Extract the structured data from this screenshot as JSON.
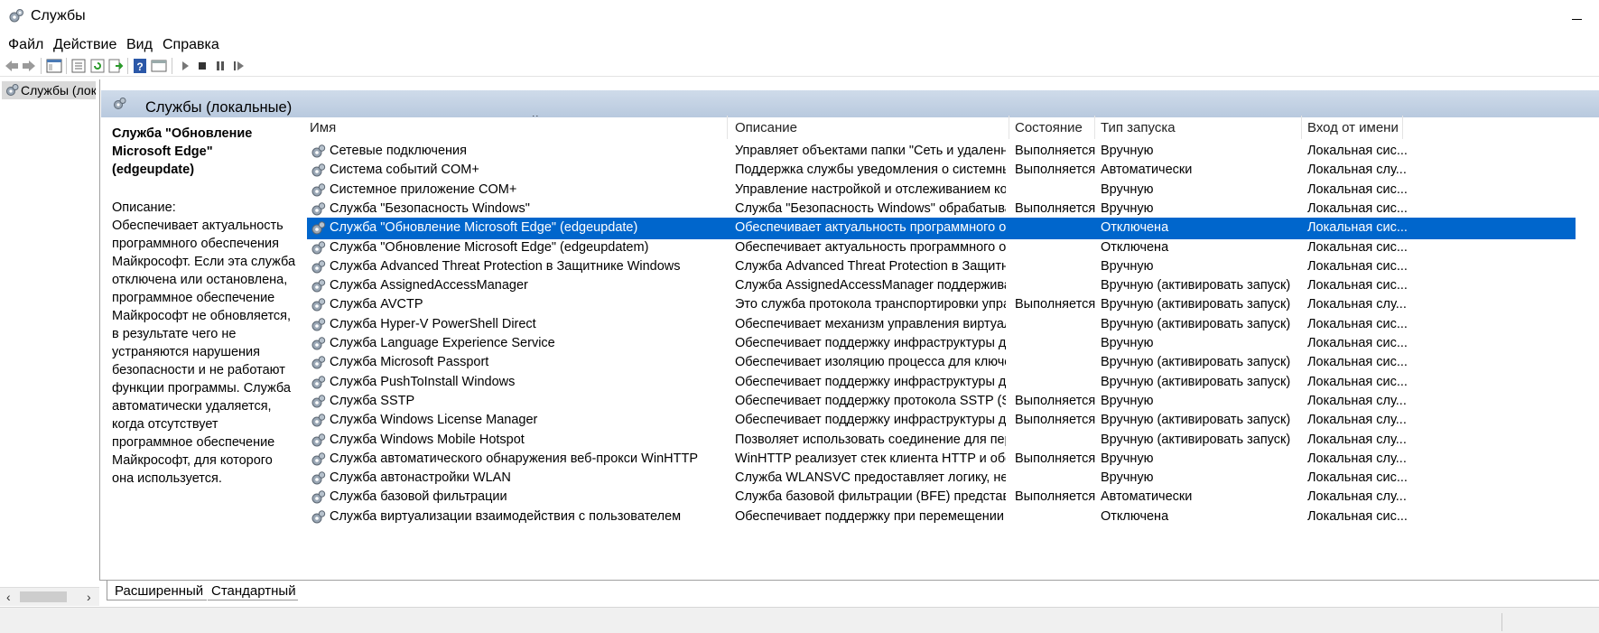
{
  "window": {
    "title": "Службы",
    "icon": "gears-icon"
  },
  "menu": [
    "Файл",
    "Действие",
    "Вид",
    "Справка"
  ],
  "toolbar": {
    "buttons": [
      "back-arrow-icon",
      "forward-arrow-icon",
      "show-hide-tree-icon",
      "properties-icon",
      "refresh-icon",
      "export-icon",
      "help-icon",
      "console-icon",
      "play-icon",
      "stop-icon",
      "pause-icon",
      "restart-icon"
    ]
  },
  "tree": {
    "item_label": "Службы (лока"
  },
  "header": {
    "title": "Службы (локальные)"
  },
  "description": {
    "service_name": "Служба \"Обновление Microsoft Edge\" (edgeupdate)",
    "label": "Описание:",
    "text": "Обеспечивает актуальность программного обеспечения Майкрософт. Если эта служба отключена или остановлена, программное обеспечение Майкрософт не обновляется, в результате чего не устраняются нарушения безопасности и не работают функции программы. Служба автоматически удаляется, когда отсутствует программное обеспечение Майкрософт, для которого она используется."
  },
  "table": {
    "columns": [
      "Имя",
      "Описание",
      "Состояние",
      "Тип запуска",
      "Вход от имени"
    ],
    "sort_indicator": "^",
    "rows": [
      [
        "Сетевые подключения",
        "Управляет объектами папки \"Сеть и удаленны...",
        "Выполняется",
        "Вручную",
        "Локальная сис..."
      ],
      [
        "Система событий COM+",
        "Поддержка службы уведомления о системных ...",
        "Выполняется",
        "Автоматически",
        "Локальная слу..."
      ],
      [
        "Системное приложение COM+",
        "Управление настройкой и отслеживанием ком...",
        "",
        "Вручную",
        "Локальная сис..."
      ],
      [
        "Служба \"Безопасность Windows\"",
        "Служба \"Безопасность Windows\" обрабатывае...",
        "Выполняется",
        "Вручную",
        "Локальная сис..."
      ],
      [
        "Служба \"Обновление Microsoft Edge\" (edgeupdate)",
        "Обеспечивает актуальность программного об...",
        "",
        "Отключена",
        "Локальная сис..."
      ],
      [
        "Служба \"Обновление Microsoft Edge\" (edgeupdatem)",
        "Обеспечивает актуальность программного об...",
        "",
        "Отключена",
        "Локальная сис..."
      ],
      [
        "Служба Advanced Threat Protection в Защитнике Windows",
        "Служба Advanced Threat Protection в Защитник...",
        "",
        "Вручную",
        "Локальная сис..."
      ],
      [
        "Служба AssignedAccessManager",
        "Служба AssignedAccessManager поддерживает ...",
        "",
        "Вручную (активировать запуск)",
        "Локальная сис..."
      ],
      [
        "Служба AVCTP",
        "Это служба протокола транспортировки управ...",
        "Выполняется",
        "Вручную (активировать запуск)",
        "Локальная слу..."
      ],
      [
        "Служба Hyper-V PowerShell Direct",
        "Обеспечивает механизм управления виртуаль...",
        "",
        "Вручную (активировать запуск)",
        "Локальная сис..."
      ],
      [
        "Служба Language Experience Service",
        "Обеспечивает поддержку инфраструктуры для ...",
        "",
        "Вручную",
        "Локальная сис..."
      ],
      [
        "Служба Microsoft Passport",
        "Обеспечивает изоляцию процесса для ключей...",
        "",
        "Вручную (активировать запуск)",
        "Локальная сис..."
      ],
      [
        "Служба PushToInstall Windows",
        "Обеспечивает поддержку инфраструктуры для ...",
        "",
        "Вручную (активировать запуск)",
        "Локальная сис..."
      ],
      [
        "Служба SSTP",
        "Обеспечивает поддержку протокола SSTP (Sec...",
        "Выполняется",
        "Вручную",
        "Локальная слу..."
      ],
      [
        "Служба Windows License Manager",
        "Обеспечивает поддержку инфраструктуры для ...",
        "Выполняется",
        "Вручную (активировать запуск)",
        "Локальная слу..."
      ],
      [
        "Служба Windows Mobile Hotspot",
        "Позволяет использовать соединение для пере...",
        "",
        "Вручную (активировать запуск)",
        "Локальная слу..."
      ],
      [
        "Служба автоматического обнаружения веб-прокси WinHTTP",
        "WinHTTP реализует стек клиента HTTP и обесп...",
        "Выполняется",
        "Вручную",
        "Локальная слу..."
      ],
      [
        "Служба автонастройки WLAN",
        "Служба WLANSVC предоставляет логику, необх...",
        "",
        "Вручную",
        "Локальная сис..."
      ],
      [
        "Служба базовой фильтрации",
        "Служба базовой фильтрации (BFE) представля...",
        "Выполняется",
        "Автоматически",
        "Локальная слу..."
      ],
      [
        "Служба виртуализации взаимодействия с пользователем",
        "Обеспечивает поддержку при перемещении п...",
        "",
        "Отключена",
        "Локальная сис..."
      ]
    ],
    "selected_index": 4
  },
  "tabs": [
    "Расширенный",
    "Стандартный"
  ],
  "colors": {
    "selection": "#0066cc",
    "header_band": "#c4d3e6"
  }
}
